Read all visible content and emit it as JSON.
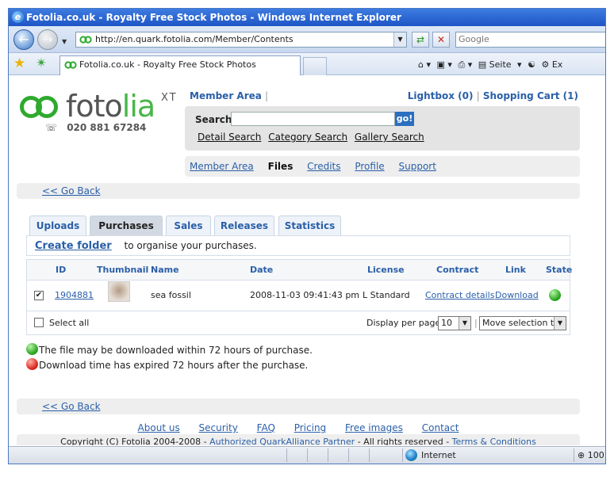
{
  "window": {
    "title": "Fotolia.co.uk - Royalty Free Stock Photos - Windows Internet Explorer"
  },
  "browser": {
    "url": "http://en.quark.fotolia.com/Member/Contents",
    "search_placeholder": "Google",
    "tab_title": "Fotolia.co.uk - Royalty Free Stock Photos",
    "page_menu_label": "Seite",
    "extras_label": "Ex",
    "zone_label": "Internet",
    "zoom_label": "100"
  },
  "header": {
    "logo_fo": "foto",
    "logo_lia": "lia",
    "logo_xt": "XT",
    "phone": "020 881 67284",
    "member_area_link": "Member Area",
    "lightbox_link": "Lightbox (0)",
    "cart_link": "Shopping Cart (1)"
  },
  "search": {
    "label": "Search",
    "value": "",
    "go_label": "go!",
    "links": [
      "Detail Search",
      "Category Search",
      "Gallery Search"
    ]
  },
  "subnav": {
    "items": [
      "Member Area",
      "Files",
      "Credits",
      "Profile",
      "Support"
    ],
    "active": "Files"
  },
  "go_back_label": "<< Go Back",
  "tabs": [
    "Uploads",
    "Purchases",
    "Sales",
    "Releases",
    "Statistics"
  ],
  "active_tab": "Purchases",
  "folder": {
    "create_label": "Create folder",
    "hint": "to organise your purchases."
  },
  "table": {
    "columns": [
      "ID",
      "Thumbnail",
      "Name",
      "Date",
      "License",
      "Contract",
      "Link",
      "State"
    ],
    "rows": [
      {
        "checked": true,
        "id": "1904881",
        "name": "sea fossil",
        "date": "2008-11-03 09:41:43 pm",
        "license": "L Standard",
        "contract": "Contract details",
        "link": "Download",
        "state": "green"
      }
    ],
    "select_all_label": "Select all",
    "per_page_label": "Display per page:",
    "per_page_value": "10",
    "move_label": "Move selection to"
  },
  "legend": {
    "green_text": "The file may be downloaded within 72 hours of purchase.",
    "red_text": "Download time has expired 72 hours after the purchase."
  },
  "footer": {
    "links": [
      "About us",
      "Security",
      "FAQ",
      "Pricing",
      "Free images",
      "Contact"
    ],
    "copyright_prefix": "Copyright (C) Fotolia 2004-2008 - ",
    "partner_link": "Authorized QuarkAlliance Partner",
    "rights_text": " - All rights reserved - ",
    "terms_link": "Terms & Conditions"
  },
  "colors": {
    "link_blue": "#2a5fa8",
    "logo_green": "#48b648",
    "state_green": "#1f9e15",
    "state_red": "#d81d10"
  }
}
